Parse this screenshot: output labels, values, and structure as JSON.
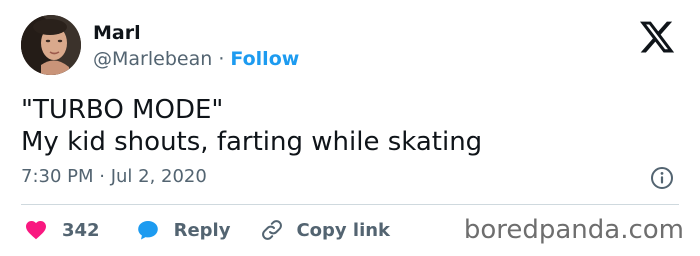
{
  "author": {
    "name": "Marl",
    "handle": "@Marlebean",
    "separator": "·",
    "follow_label": "Follow"
  },
  "tweet": {
    "lines": [
      "\"TURBO MODE\"",
      "My kid shouts, farting while skating"
    ],
    "timestamp": "7:30 PM · Jul 2, 2020"
  },
  "actions": {
    "likes_count": "342",
    "reply_label": "Reply",
    "copy_link_label": "Copy link"
  },
  "watermark": "boredpanda.com",
  "colors": {
    "accent": "#1d9bf0",
    "heart": "#f91880",
    "text": "#0f1419",
    "secondary": "#536471"
  },
  "icons": [
    "x-logo-icon",
    "info-icon",
    "heart-icon",
    "reply-bubble-icon",
    "link-icon"
  ]
}
